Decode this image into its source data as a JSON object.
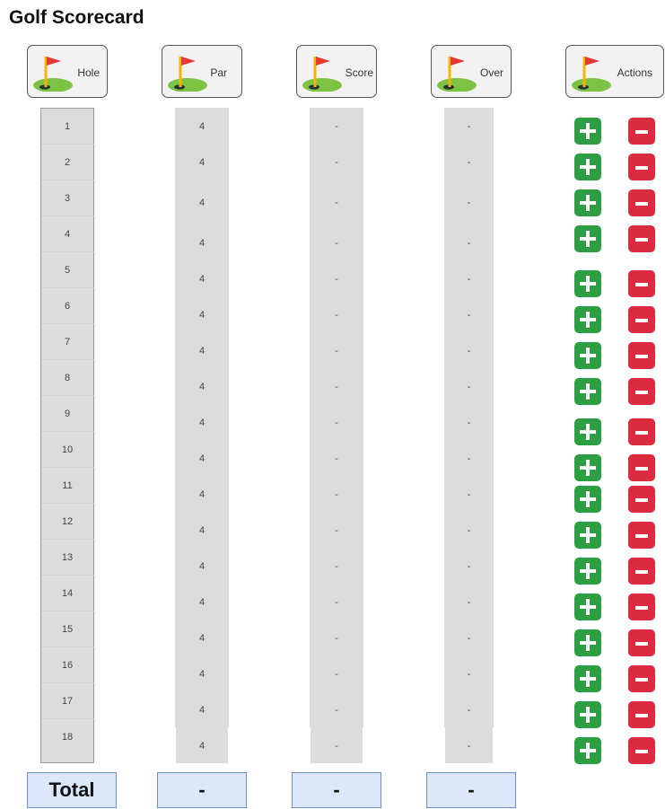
{
  "title": "Golf Scorecard",
  "columns": {
    "hole": "Hole",
    "par": "Par",
    "score": "Score",
    "over": "Over",
    "actions": "Actions"
  },
  "header_icon": "golf-flag-icon",
  "holes": [
    {
      "hole": "1",
      "par": "4",
      "score": "-",
      "over": "-"
    },
    {
      "hole": "2",
      "par": "4",
      "score": "-",
      "over": "-"
    },
    {
      "hole": "3",
      "par": "4",
      "score": "-",
      "over": "-"
    },
    {
      "hole": "4",
      "par": "4",
      "score": "-",
      "over": "-"
    },
    {
      "hole": "5",
      "par": "4",
      "score": "-",
      "over": "-"
    },
    {
      "hole": "6",
      "par": "4",
      "score": "-",
      "over": "-"
    },
    {
      "hole": "7",
      "par": "4",
      "score": "-",
      "over": "-"
    },
    {
      "hole": "8",
      "par": "4",
      "score": "-",
      "over": "-"
    },
    {
      "hole": "9",
      "par": "4",
      "score": "-",
      "over": "-"
    },
    {
      "hole": "10",
      "par": "4",
      "score": "-",
      "over": "-"
    },
    {
      "hole": "11",
      "par": "4",
      "score": "-",
      "over": "-"
    },
    {
      "hole": "12",
      "par": "4",
      "score": "-",
      "over": "-"
    },
    {
      "hole": "13",
      "par": "4",
      "score": "-",
      "over": "-"
    },
    {
      "hole": "14",
      "par": "4",
      "score": "-",
      "over": "-"
    },
    {
      "hole": "15",
      "par": "4",
      "score": "-",
      "over": "-"
    },
    {
      "hole": "16",
      "par": "4",
      "score": "-",
      "over": "-"
    },
    {
      "hole": "17",
      "par": "4",
      "score": "-",
      "over": "-"
    },
    {
      "hole": "18",
      "par": "4",
      "score": "-",
      "over": "-"
    }
  ],
  "actions": {
    "increment_icon": "plus-icon",
    "decrement_icon": "minus-icon"
  },
  "totals": {
    "label": "Total",
    "par": "-",
    "score": "-",
    "over": "-"
  },
  "colors": {
    "increment": "#2e9e44",
    "decrement": "#dc2b3e",
    "total_fill": "#dbe7fb"
  }
}
